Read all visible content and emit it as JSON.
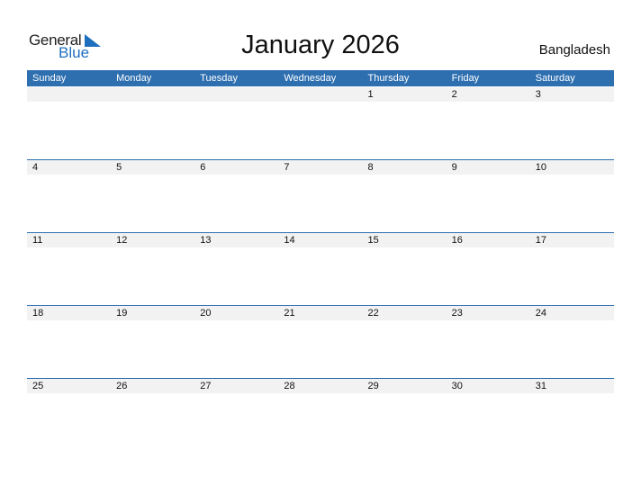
{
  "logo": {
    "word1": "General",
    "word2": "Blue",
    "brand_color": "#1f6fbf"
  },
  "title": "January 2026",
  "country": "Bangladesh",
  "header_color": "#2e6fb0",
  "weekdays": [
    "Sunday",
    "Monday",
    "Tuesday",
    "Wednesday",
    "Thursday",
    "Friday",
    "Saturday"
  ],
  "weeks": [
    [
      "",
      "",
      "",
      "",
      "1",
      "2",
      "3"
    ],
    [
      "4",
      "5",
      "6",
      "7",
      "8",
      "9",
      "10"
    ],
    [
      "11",
      "12",
      "13",
      "14",
      "15",
      "16",
      "17"
    ],
    [
      "18",
      "19",
      "20",
      "21",
      "22",
      "23",
      "24"
    ],
    [
      "25",
      "26",
      "27",
      "28",
      "29",
      "30",
      "31"
    ]
  ]
}
